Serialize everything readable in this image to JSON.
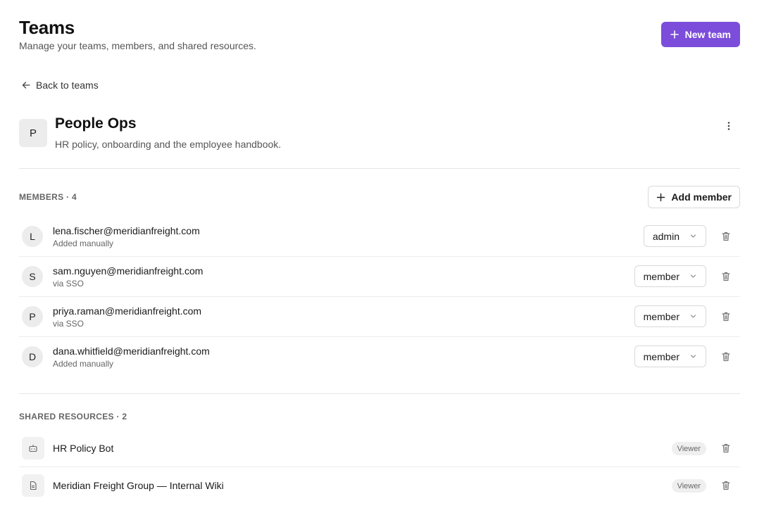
{
  "header": {
    "title": "Teams",
    "subtitle": "Manage your teams, members, and shared resources.",
    "new_team_label": "New team"
  },
  "back_label": "Back to teams",
  "team": {
    "initial": "P",
    "name": "People Ops",
    "description": "HR policy, onboarding and the employee handbook."
  },
  "members": {
    "section_label": "MEMBERS · 4",
    "add_label": "Add member",
    "items": [
      {
        "initial": "L",
        "email": "lena.fischer@meridianfreight.com",
        "source": "Added manually",
        "role": "admin"
      },
      {
        "initial": "S",
        "email": "sam.nguyen@meridianfreight.com",
        "source": "via SSO",
        "role": "member"
      },
      {
        "initial": "P",
        "email": "priya.raman@meridianfreight.com",
        "source": "via SSO",
        "role": "member"
      },
      {
        "initial": "D",
        "email": "dana.whitfield@meridianfreight.com",
        "source": "Added manually",
        "role": "member"
      }
    ]
  },
  "resources": {
    "section_label": "SHARED RESOURCES · 2",
    "items": [
      {
        "icon": "bot-icon",
        "name": "HR Policy Bot",
        "access": "Viewer"
      },
      {
        "icon": "document-icon",
        "name": "Meridian Freight Group — Internal Wiki",
        "access": "Viewer"
      }
    ]
  },
  "colors": {
    "accent": "#7c4ddb"
  }
}
